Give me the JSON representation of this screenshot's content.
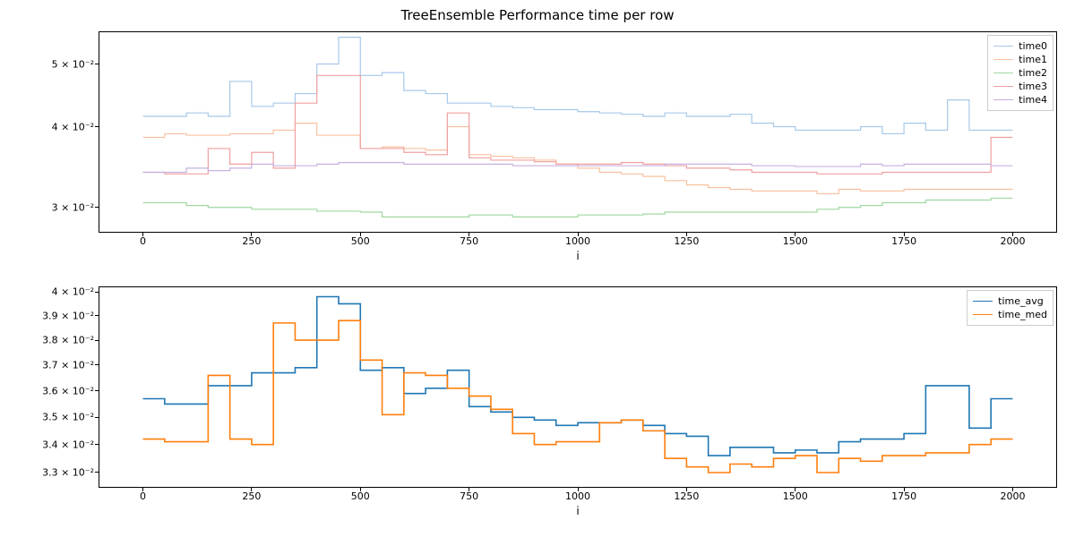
{
  "title": "TreeEnsemble Performance time per row",
  "x_bins": [
    0,
    50,
    100,
    150,
    200,
    250,
    300,
    350,
    400,
    450,
    500,
    550,
    600,
    650,
    700,
    750,
    800,
    850,
    900,
    950,
    1000,
    1050,
    1100,
    1150,
    1200,
    1250,
    1300,
    1350,
    1400,
    1450,
    1500,
    1550,
    1600,
    1650,
    1700,
    1750,
    1800,
    1850,
    1900,
    1950,
    2000
  ],
  "top": {
    "xlabel": "i",
    "xticks": [
      0,
      250,
      500,
      750,
      1000,
      1250,
      1500,
      1750,
      2000
    ],
    "yticks": [
      {
        "v": 0.03,
        "label": "3 × 10⁻²"
      },
      {
        "v": 0.04,
        "label": "4 × 10⁻²"
      },
      {
        "v": 0.05,
        "label": "5 × 10⁻²"
      }
    ],
    "ymin": 0.0275,
    "ymax": 0.056,
    "series": [
      {
        "name": "time0",
        "color": "#a8c8e8",
        "values": [
          0.0415,
          0.0415,
          0.042,
          0.0415,
          0.047,
          0.043,
          0.0435,
          0.045,
          0.05,
          0.055,
          0.048,
          0.0485,
          0.0455,
          0.045,
          0.0435,
          0.0435,
          0.043,
          0.0428,
          0.0425,
          0.0425,
          0.0422,
          0.042,
          0.0418,
          0.0415,
          0.042,
          0.0415,
          0.0415,
          0.0418,
          0.0405,
          0.04,
          0.0395,
          0.0395,
          0.0395,
          0.04,
          0.039,
          0.0405,
          0.0395,
          0.044,
          0.0395,
          0.0395
        ]
      },
      {
        "name": "time1",
        "color": "#f8c0a0",
        "values": [
          0.0385,
          0.039,
          0.0388,
          0.0388,
          0.039,
          0.039,
          0.0395,
          0.0405,
          0.0388,
          0.0388,
          0.037,
          0.0372,
          0.037,
          0.0368,
          0.04,
          0.0362,
          0.036,
          0.0358,
          0.0355,
          0.035,
          0.0345,
          0.034,
          0.0338,
          0.0335,
          0.033,
          0.0325,
          0.0322,
          0.032,
          0.0318,
          0.0318,
          0.0318,
          0.0315,
          0.032,
          0.0318,
          0.0318,
          0.032,
          0.032,
          0.032,
          0.032,
          0.032
        ]
      },
      {
        "name": "time2",
        "color": "#a0d8a0",
        "values": [
          0.0305,
          0.0305,
          0.0302,
          0.03,
          0.03,
          0.0298,
          0.0298,
          0.0298,
          0.0296,
          0.0296,
          0.0295,
          0.029,
          0.029,
          0.029,
          0.029,
          0.0292,
          0.0292,
          0.029,
          0.029,
          0.029,
          0.0292,
          0.0292,
          0.0292,
          0.0293,
          0.0295,
          0.0295,
          0.0295,
          0.0295,
          0.0295,
          0.0295,
          0.0295,
          0.0298,
          0.03,
          0.0302,
          0.0305,
          0.0305,
          0.0308,
          0.0308,
          0.0308,
          0.031
        ]
      },
      {
        "name": "time3",
        "color": "#f0a0a0",
        "values": [
          0.034,
          0.0338,
          0.0338,
          0.037,
          0.035,
          0.0365,
          0.0345,
          0.0435,
          0.048,
          0.048,
          0.037,
          0.037,
          0.0365,
          0.0362,
          0.042,
          0.0358,
          0.0355,
          0.0355,
          0.0353,
          0.035,
          0.035,
          0.035,
          0.0352,
          0.035,
          0.0348,
          0.0345,
          0.0345,
          0.0343,
          0.034,
          0.034,
          0.034,
          0.0338,
          0.0338,
          0.0338,
          0.034,
          0.034,
          0.034,
          0.034,
          0.034,
          0.0385
        ]
      },
      {
        "name": "time4",
        "color": "#c8b0e0",
        "values": [
          0.034,
          0.034,
          0.0345,
          0.0342,
          0.0345,
          0.035,
          0.0348,
          0.0348,
          0.035,
          0.0352,
          0.0352,
          0.0352,
          0.035,
          0.035,
          0.035,
          0.035,
          0.035,
          0.0348,
          0.0348,
          0.0348,
          0.0348,
          0.0348,
          0.0348,
          0.0348,
          0.035,
          0.035,
          0.035,
          0.035,
          0.0348,
          0.0348,
          0.0347,
          0.0347,
          0.0347,
          0.035,
          0.0348,
          0.035,
          0.035,
          0.035,
          0.035,
          0.0348
        ]
      }
    ]
  },
  "bot": {
    "xlabel": "i",
    "xticks": [
      0,
      250,
      500,
      750,
      1000,
      1250,
      1500,
      1750,
      2000
    ],
    "yticks": [
      {
        "v": 0.033,
        "label": "3.3 × 10⁻²"
      },
      {
        "v": 0.034,
        "label": "3.4 × 10⁻²"
      },
      {
        "v": 0.035,
        "label": "3.5 × 10⁻²"
      },
      {
        "v": 0.036,
        "label": "3.6 × 10⁻²"
      },
      {
        "v": 0.037,
        "label": "3.7 × 10⁻²"
      },
      {
        "v": 0.038,
        "label": "3.8 × 10⁻²"
      },
      {
        "v": 0.039,
        "label": "3.9 × 10⁻²"
      },
      {
        "v": 0.04,
        "label": "4 × 10⁻²"
      }
    ],
    "ymin": 0.0325,
    "ymax": 0.0402,
    "series": [
      {
        "name": "time_avg",
        "color": "#1f77b4",
        "values": [
          0.0357,
          0.0355,
          0.0355,
          0.0362,
          0.0362,
          0.0367,
          0.0367,
          0.0369,
          0.0398,
          0.0395,
          0.0368,
          0.0369,
          0.0359,
          0.0361,
          0.0368,
          0.0354,
          0.0352,
          0.035,
          0.0349,
          0.0347,
          0.0348,
          0.0348,
          0.0349,
          0.0347,
          0.0344,
          0.0343,
          0.0336,
          0.0339,
          0.0339,
          0.0337,
          0.0338,
          0.0337,
          0.0341,
          0.0342,
          0.0342,
          0.0344,
          0.0362,
          0.0362,
          0.0346,
          0.0357
        ]
      },
      {
        "name": "time_med",
        "color": "#ff7f0e",
        "values": [
          0.0342,
          0.0341,
          0.0341,
          0.0366,
          0.0342,
          0.034,
          0.0387,
          0.038,
          0.038,
          0.0388,
          0.0372,
          0.0351,
          0.0367,
          0.0366,
          0.0361,
          0.0358,
          0.0353,
          0.0344,
          0.034,
          0.0341,
          0.0341,
          0.0348,
          0.0349,
          0.0345,
          0.0335,
          0.0332,
          0.033,
          0.0333,
          0.0332,
          0.0335,
          0.0336,
          0.033,
          0.0335,
          0.0334,
          0.0336,
          0.0336,
          0.0337,
          0.0337,
          0.034,
          0.0342
        ]
      }
    ]
  },
  "chart_data": [
    {
      "type": "line",
      "title": "TreeEnsemble Performance time per row",
      "step": "post",
      "xlabel": "i",
      "ylabel": "",
      "yscale": "log",
      "xlim": [
        0,
        2000
      ],
      "ylim": [
        0.0275,
        0.056
      ],
      "x": [
        0,
        50,
        100,
        150,
        200,
        250,
        300,
        350,
        400,
        450,
        500,
        550,
        600,
        650,
        700,
        750,
        800,
        850,
        900,
        950,
        1000,
        1050,
        1100,
        1150,
        1200,
        1250,
        1300,
        1350,
        1400,
        1450,
        1500,
        1550,
        1600,
        1650,
        1700,
        1750,
        1800,
        1850,
        1900,
        1950
      ],
      "series": [
        {
          "name": "time0",
          "values": [
            0.0415,
            0.0415,
            0.042,
            0.0415,
            0.047,
            0.043,
            0.0435,
            0.045,
            0.05,
            0.055,
            0.048,
            0.0485,
            0.0455,
            0.045,
            0.0435,
            0.0435,
            0.043,
            0.0428,
            0.0425,
            0.0425,
            0.0422,
            0.042,
            0.0418,
            0.0415,
            0.042,
            0.0415,
            0.0415,
            0.0418,
            0.0405,
            0.04,
            0.0395,
            0.0395,
            0.0395,
            0.04,
            0.039,
            0.0405,
            0.0395,
            0.044,
            0.0395,
            0.0395
          ]
        },
        {
          "name": "time1",
          "values": [
            0.0385,
            0.039,
            0.0388,
            0.0388,
            0.039,
            0.039,
            0.0395,
            0.0405,
            0.0388,
            0.0388,
            0.037,
            0.0372,
            0.037,
            0.0368,
            0.04,
            0.0362,
            0.036,
            0.0358,
            0.0355,
            0.035,
            0.0345,
            0.034,
            0.0338,
            0.0335,
            0.033,
            0.0325,
            0.0322,
            0.032,
            0.0318,
            0.0318,
            0.0318,
            0.0315,
            0.032,
            0.0318,
            0.0318,
            0.032,
            0.032,
            0.032,
            0.032,
            0.032
          ]
        },
        {
          "name": "time2",
          "values": [
            0.0305,
            0.0305,
            0.0302,
            0.03,
            0.03,
            0.0298,
            0.0298,
            0.0298,
            0.0296,
            0.0296,
            0.0295,
            0.029,
            0.029,
            0.029,
            0.029,
            0.0292,
            0.0292,
            0.029,
            0.029,
            0.029,
            0.0292,
            0.0292,
            0.0292,
            0.0293,
            0.0295,
            0.0295,
            0.0295,
            0.0295,
            0.0295,
            0.0295,
            0.0295,
            0.0298,
            0.03,
            0.0302,
            0.0305,
            0.0305,
            0.0308,
            0.0308,
            0.0308,
            0.031
          ]
        },
        {
          "name": "time3",
          "values": [
            0.034,
            0.0338,
            0.0338,
            0.037,
            0.035,
            0.0365,
            0.0345,
            0.0435,
            0.048,
            0.048,
            0.037,
            0.037,
            0.0365,
            0.0362,
            0.042,
            0.0358,
            0.0355,
            0.0355,
            0.0353,
            0.035,
            0.035,
            0.035,
            0.0352,
            0.035,
            0.0348,
            0.0345,
            0.0345,
            0.0343,
            0.034,
            0.034,
            0.034,
            0.0338,
            0.0338,
            0.0338,
            0.034,
            0.034,
            0.034,
            0.034,
            0.034,
            0.0385
          ]
        },
        {
          "name": "time4",
          "values": [
            0.034,
            0.034,
            0.0345,
            0.0342,
            0.0345,
            0.035,
            0.0348,
            0.0348,
            0.035,
            0.0352,
            0.0352,
            0.0352,
            0.035,
            0.035,
            0.035,
            0.035,
            0.035,
            0.0348,
            0.0348,
            0.0348,
            0.0348,
            0.0348,
            0.0348,
            0.0348,
            0.035,
            0.035,
            0.035,
            0.035,
            0.0348,
            0.0348,
            0.0347,
            0.0347,
            0.0347,
            0.035,
            0.0348,
            0.035,
            0.035,
            0.035,
            0.035,
            0.0348
          ]
        }
      ]
    },
    {
      "type": "line",
      "step": "post",
      "xlabel": "i",
      "ylabel": "",
      "yscale": "log",
      "xlim": [
        0,
        2000
      ],
      "ylim": [
        0.0325,
        0.0402
      ],
      "x": [
        0,
        50,
        100,
        150,
        200,
        250,
        300,
        350,
        400,
        450,
        500,
        550,
        600,
        650,
        700,
        750,
        800,
        850,
        900,
        950,
        1000,
        1050,
        1100,
        1150,
        1200,
        1250,
        1300,
        1350,
        1400,
        1450,
        1500,
        1550,
        1600,
        1650,
        1700,
        1750,
        1800,
        1850,
        1900,
        1950
      ],
      "series": [
        {
          "name": "time_avg",
          "values": [
            0.0357,
            0.0355,
            0.0355,
            0.0362,
            0.0362,
            0.0367,
            0.0367,
            0.0369,
            0.0398,
            0.0395,
            0.0368,
            0.0369,
            0.0359,
            0.0361,
            0.0368,
            0.0354,
            0.0352,
            0.035,
            0.0349,
            0.0347,
            0.0348,
            0.0348,
            0.0349,
            0.0347,
            0.0344,
            0.0343,
            0.0336,
            0.0339,
            0.0339,
            0.0337,
            0.0338,
            0.0337,
            0.0341,
            0.0342,
            0.0342,
            0.0344,
            0.0362,
            0.0362,
            0.0346,
            0.0357
          ]
        },
        {
          "name": "time_med",
          "values": [
            0.0342,
            0.0341,
            0.0341,
            0.0366,
            0.0342,
            0.034,
            0.0387,
            0.038,
            0.038,
            0.0388,
            0.0372,
            0.0351,
            0.0367,
            0.0366,
            0.0361,
            0.0358,
            0.0353,
            0.0344,
            0.034,
            0.0341,
            0.0341,
            0.0348,
            0.0349,
            0.0345,
            0.0335,
            0.0332,
            0.033,
            0.0333,
            0.0332,
            0.0335,
            0.0336,
            0.033,
            0.0335,
            0.0334,
            0.0336,
            0.0336,
            0.0337,
            0.0337,
            0.034,
            0.0342
          ]
        }
      ]
    }
  ]
}
